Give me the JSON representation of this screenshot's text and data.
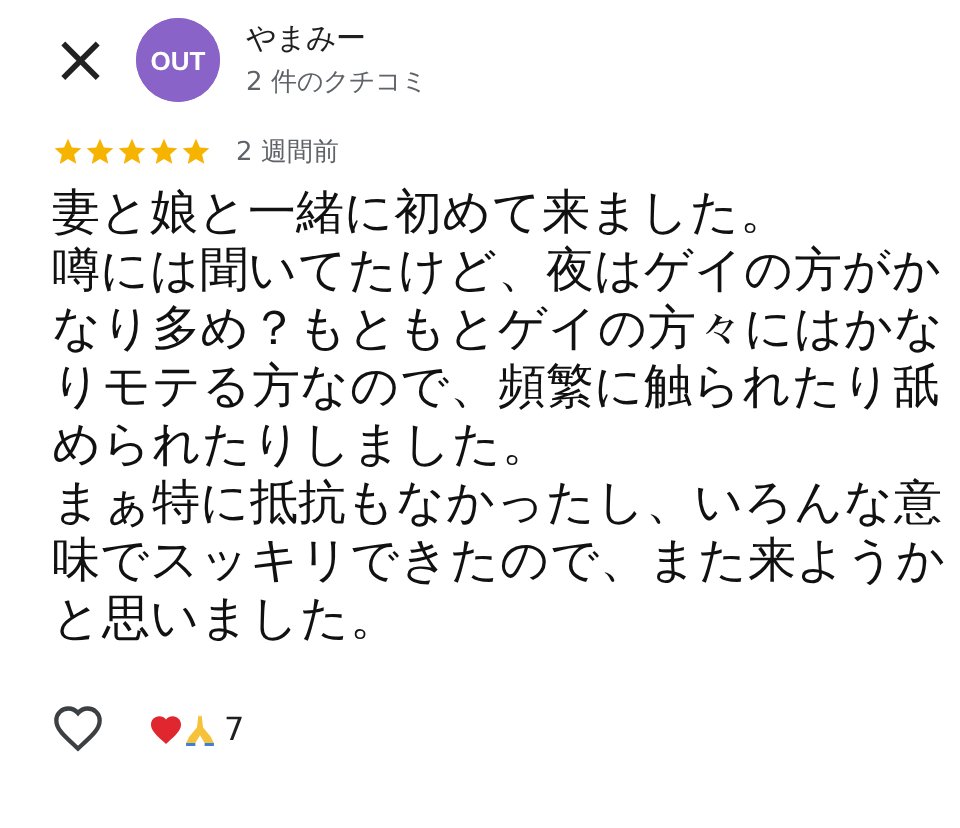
{
  "header": {
    "close": "×",
    "avatar_text": "OUT",
    "name": "やまみー",
    "review_count": "2 件のクチコミ"
  },
  "review": {
    "stars": 5,
    "time": "2 週間前",
    "body": [
      "妻と娘と一緒に初めて来ました。",
      "噂には聞いてたけど、夜はゲイの方がかなり多め？もともとゲイの方々にはかなりモテる方なので、頻繁に触られたり舐められたりしました。",
      "まぁ特に抵抗もなかったし、いろんな意味でスッキリできたので、また来ようかと思いました。"
    ]
  },
  "footer": {
    "liked": false,
    "reaction_count": "7"
  }
}
